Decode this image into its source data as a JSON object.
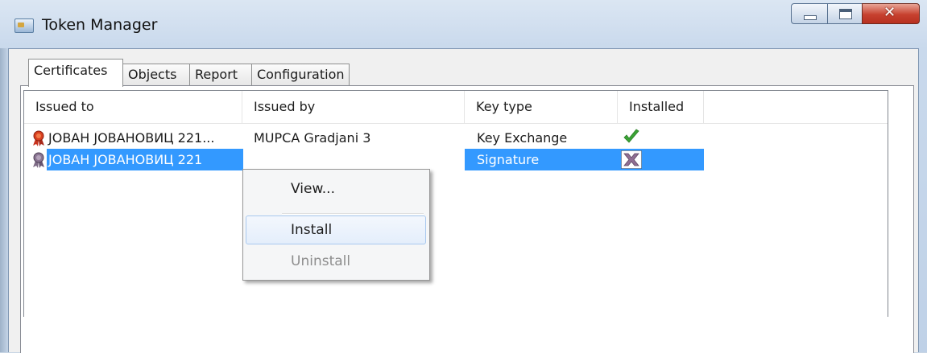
{
  "window": {
    "title": "Token Manager"
  },
  "tabs": [
    {
      "label": "Certificates",
      "active": true
    },
    {
      "label": "Objects",
      "active": false
    },
    {
      "label": "Report",
      "active": false
    },
    {
      "label": "Configuration",
      "active": false
    }
  ],
  "list": {
    "columns": [
      "Issued to",
      "Issued by",
      "Key type",
      "Installed"
    ],
    "rows": [
      {
        "issued_to": "ЈОВАН ЈОВАНОВИЦ 221...",
        "issued_by": "MUPCA Gradjani 3",
        "key_type": "Key Exchange",
        "installed_icon": "green-checkmark-icon",
        "selected": false
      },
      {
        "issued_to": "ЈОВАН ЈОВАНОВИЦ 221",
        "issued_by": "",
        "key_type": "Signature",
        "installed_icon": "purple-x-icon",
        "selected": true
      }
    ]
  },
  "context_menu": {
    "items": [
      {
        "label": "View...",
        "enabled": true
      },
      {
        "label": "Install",
        "enabled": true,
        "hovered": true
      },
      {
        "label": "Uninstall",
        "enabled": false
      }
    ]
  },
  "colors": {
    "selection": "#3399ff",
    "check_green": "#3aa335",
    "x_purple": "#8f6e93",
    "ribbon_red": "#c8321e",
    "ribbon_purple": "#7d6a85"
  }
}
